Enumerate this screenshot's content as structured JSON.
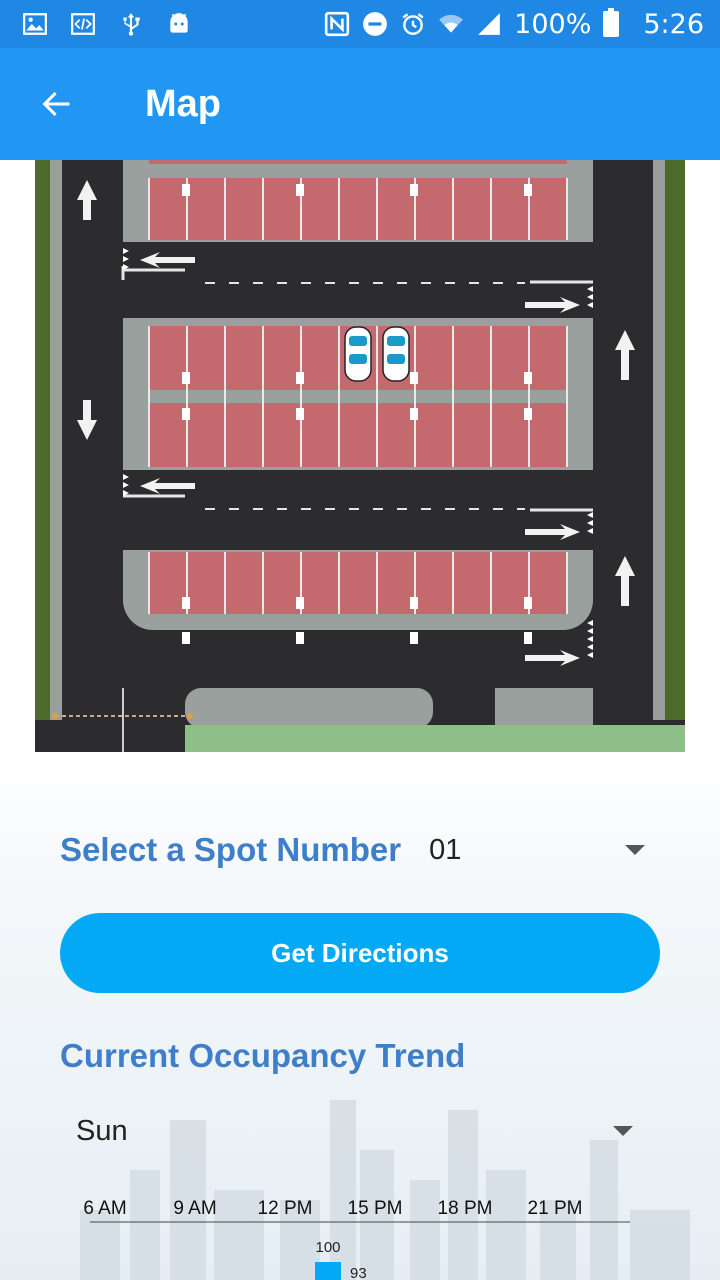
{
  "status_bar": {
    "battery_percent": "100%",
    "time": "5:26",
    "icons": [
      "image-icon",
      "code-icon",
      "usb-icon",
      "android-debug-icon",
      "nfc-icon",
      "do-not-disturb-icon",
      "alarm-icon",
      "wifi-icon",
      "signal-icon",
      "battery-icon"
    ]
  },
  "app_bar": {
    "title": "Map",
    "back_icon": "arrow-back-icon",
    "color": "#2196f3"
  },
  "form": {
    "spot_label": "Select a Spot Number",
    "spot_value": "01",
    "directions_label": "Get Directions",
    "trend_title": "Current Occupancy Trend",
    "day_value": "Sun"
  },
  "chart_data": {
    "type": "bar",
    "x_ticks": [
      "6 AM",
      "9 AM",
      "12 PM",
      "15 PM",
      "18 PM",
      "21 PM"
    ],
    "ymax_label": "100",
    "series": [
      {
        "values": [
          93
        ]
      }
    ],
    "value_label": "93",
    "accent": "#03a9f4"
  },
  "colors": {
    "accent": "#2196f3",
    "button": "#03a9f4",
    "heading": "#3f7fc9"
  }
}
